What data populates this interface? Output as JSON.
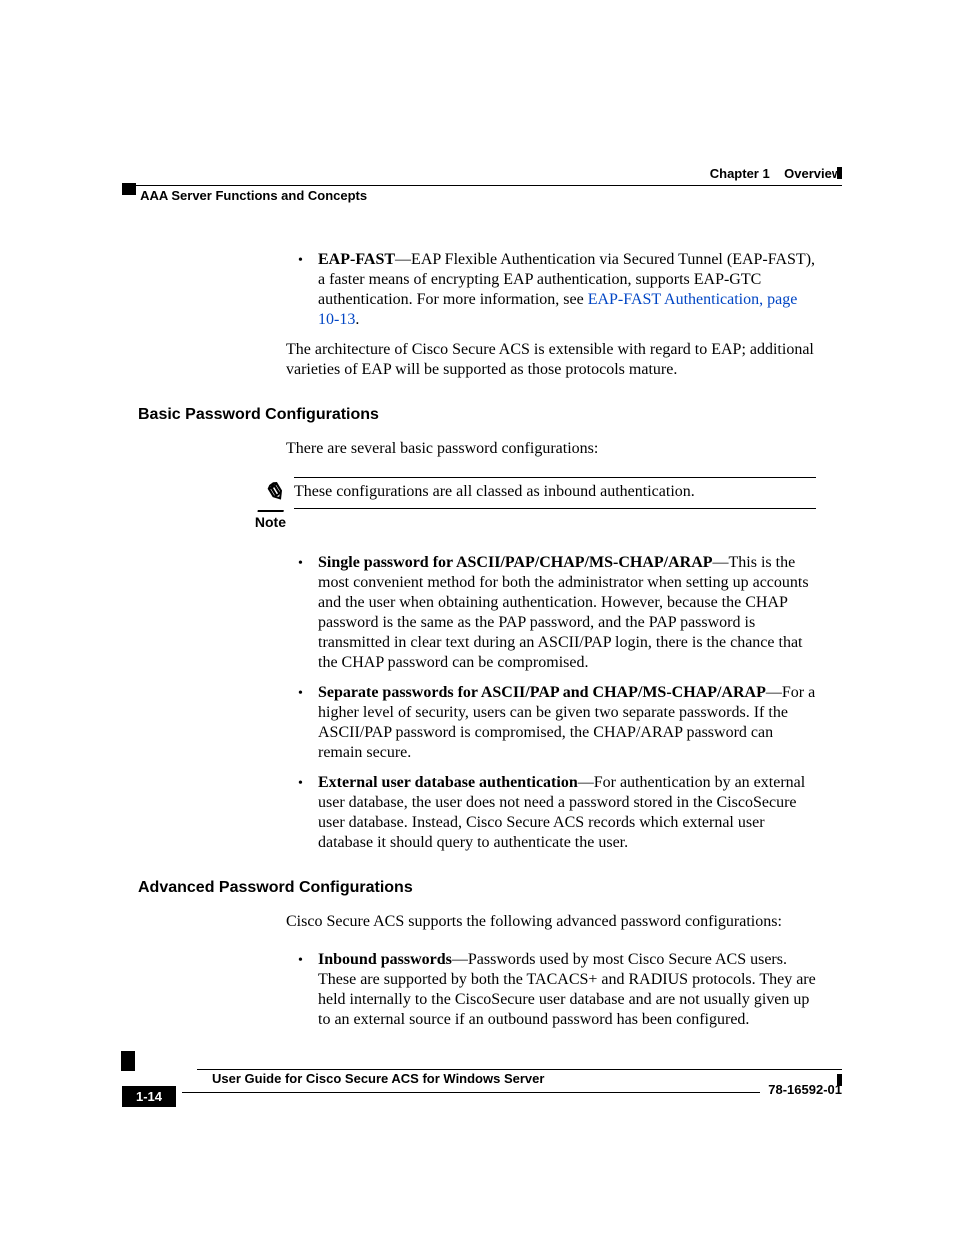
{
  "header": {
    "chapter": "Chapter 1",
    "title": "Overview",
    "section": "AAA Server Functions and Concepts"
  },
  "body": {
    "bullets1": [
      {
        "bold": "EAP-FAST",
        "text": "—EAP Flexible Authentication via Secured Tunnel (EAP-FAST), a faster means of encrypting EAP authentication, supports EAP-GTC authentication. For more information, see ",
        "link": "EAP-FAST Authentication, page 10-13",
        "trail": "."
      }
    ],
    "para1": "The architecture of Cisco Secure ACS is extensible with regard to EAP; additional varieties of EAP will be supported as those protocols mature.",
    "h1": "Basic Password Configurations",
    "para2": "There are several basic password configurations:",
    "note": {
      "label": "Note",
      "text": "These configurations are all classed as inbound authentication."
    },
    "bullets2": [
      {
        "bold": "Single password for ASCII/PAP/CHAP/MS-CHAP/ARAP",
        "text": "—This is the most convenient method for both the administrator when setting up accounts and the user when obtaining authentication. However, because the CHAP password is the same as the PAP password, and the PAP password is transmitted in clear text during an ASCII/PAP login, there is the chance that the CHAP password can be compromised."
      },
      {
        "bold": "Separate passwords for ASCII/PAP and CHAP/MS-CHAP/ARAP",
        "text": "—For a higher level of security, users can be given two separate passwords. If the ASCII/PAP password is compromised, the CHAP/ARAP password can remain secure."
      },
      {
        "bold": "External user database authentication",
        "text": "—For authentication by an external user database, the user does not need a password stored in the CiscoSecure user database. Instead, Cisco Secure ACS records which external user database it should query to authenticate the user."
      }
    ],
    "h2": "Advanced Password Configurations",
    "para3": "Cisco Secure ACS supports the following advanced password configurations:",
    "bullets3": [
      {
        "bold": "Inbound passwords",
        "text": "—Passwords used by most Cisco Secure ACS users. These are supported by both the TACACS+ and RADIUS protocols. They are held internally to the CiscoSecure user database and are not usually given up to an external source if an outbound password has been configured."
      }
    ]
  },
  "footer": {
    "guide_title": "User Guide for Cisco Secure ACS for Windows Server",
    "page": "1-14",
    "doc_number": "78-16592-01"
  }
}
